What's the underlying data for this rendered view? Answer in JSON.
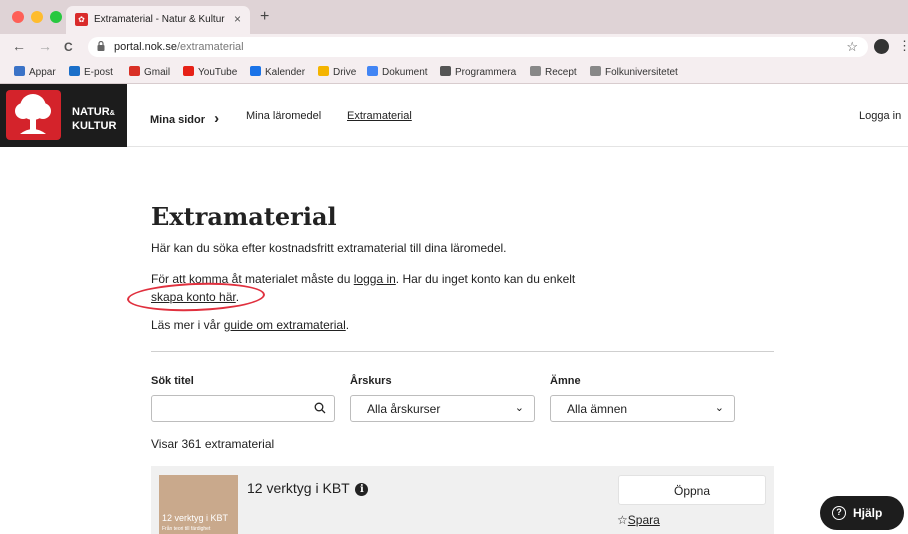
{
  "browser": {
    "tab_title": "Extramaterial - Natur & Kultur",
    "tab_close": "×",
    "new_tab": "+",
    "url_domain": "portal.nok.se",
    "url_path": "/extramaterial",
    "nav": {
      "back": "←",
      "forward": "→",
      "reload": "C"
    },
    "star": "☆",
    "menu": "⋮"
  },
  "bookmarks": [
    {
      "label": "Appar",
      "color": "#3b73c7"
    },
    {
      "label": "E-post",
      "color": "#1b6fc9"
    },
    {
      "label": "Gmail",
      "color": "#d93025"
    },
    {
      "label": "YouTube",
      "color": "#e62117"
    },
    {
      "label": "Kalender",
      "color": "#1a73e8"
    },
    {
      "label": "Drive",
      "color": "#f4b400"
    },
    {
      "label": "Dokument",
      "color": "#4285f4"
    },
    {
      "label": "Programmera",
      "color": "#555555"
    },
    {
      "label": "Recept",
      "color": "#888888"
    },
    {
      "label": "Folkuniversitetet",
      "color": "#888888"
    }
  ],
  "header": {
    "logo_line1": "NATUR",
    "logo_amp": "&",
    "logo_line2": "KULTUR",
    "nav_mina_sidor": "Mina sidor",
    "nav_chevron": "›",
    "nav_laromedel": "Mina läromedel",
    "nav_extramaterial": "Extramaterial",
    "login": "Logga in"
  },
  "main": {
    "title": "Extramaterial",
    "intro": "Här kan du söka efter kostnadsfritt extramaterial till dina läromedel.",
    "access_pre": "För att komma åt materialet måste du ",
    "access_link": "logga in",
    "access_post": ". Har du inget konto kan du enkelt",
    "create_link": "skapa konto här",
    "create_post": ".",
    "guide_pre": "Läs mer i vår ",
    "guide_link": "guide om extramaterial",
    "guide_post": "."
  },
  "filters": {
    "title_label": "Sök titel",
    "title_value": "",
    "grade_label": "Årskurs",
    "grade_value": "Alla årskurser",
    "subject_label": "Ämne",
    "subject_value": "Alla ämnen",
    "chevron": "⌄"
  },
  "results": {
    "count_text": "Visar 361 extramaterial",
    "items": [
      {
        "title": "12 verktyg i KBT",
        "info": "i",
        "thumb_title": "12 verktyg i KBT",
        "thumb_subtitle": "Från teori till färdighet",
        "open_label": "Öppna",
        "save_icon": "☆",
        "save_label": "Spara"
      }
    ]
  },
  "help": {
    "icon": "?",
    "label": "Hjälp"
  }
}
